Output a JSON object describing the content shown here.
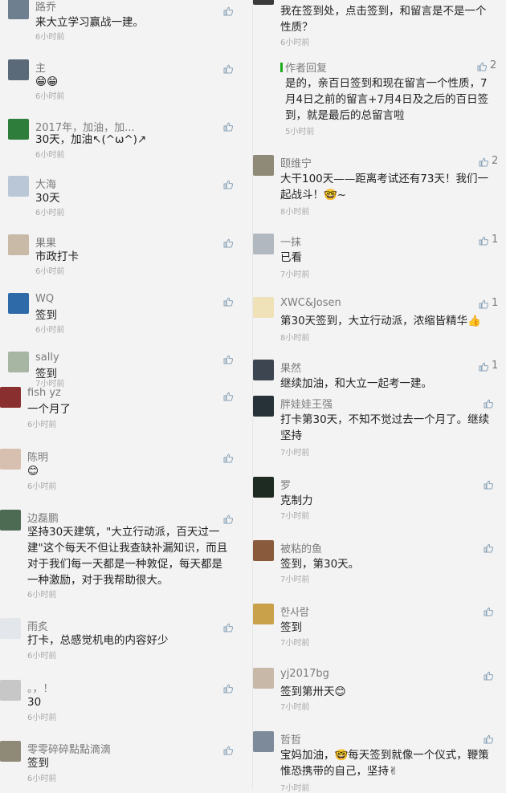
{
  "left": [
    {
      "name": "路乔",
      "text": "来大立学习赢战一建。",
      "time": "6小时前"
    },
    {
      "name": "主",
      "text": "😁😁",
      "time": "6小时前"
    },
    {
      "name": "2017年，加油，加...",
      "text": "30天，加油↖(^ω^)↗",
      "time": "6小时前"
    },
    {
      "name": "大海",
      "text": "30天",
      "time": "6小时前"
    },
    {
      "name": "果果",
      "text": "市政打卡",
      "time": "6小时前"
    },
    {
      "name": "WQ",
      "text": "签到",
      "time": "6小时前"
    },
    {
      "name": "sally",
      "text": "签到",
      "time": "7小时前"
    },
    {
      "name": "fish yz",
      "text": "一个月了",
      "time": "6小时前"
    },
    {
      "name": "陈明",
      "text": "😊",
      "time": "6小时前"
    },
    {
      "name": "边磊鹏",
      "text": "坚持30天建筑，\"大立行动派，百天过一建\"这个每天不但让我查缺补漏知识，而且对于我们每一天都是一种敦促，每天都是一种激励，对于我帮助很大。",
      "time": "6小时前"
    },
    {
      "name": "雨炙",
      "text": "打卡，总感觉机电的内容好少",
      "time": "6小时前"
    },
    {
      "name": "。，！",
      "text": "30",
      "time": "6小时前"
    },
    {
      "name": "零零碎碎點點滴滴",
      "text": "签到",
      "time": "6小时前"
    }
  ],
  "right": [
    {
      "text": "我在签到处，点击签到，和留言是不是一个性质？",
      "time": "6小时前"
    },
    {
      "reply_label": "作者回复",
      "text": "是的，亲百日签到和现在留言一个性质，7月4日之前的留言+7月4日及之后的百日签到，就是最后的总留言啦",
      "time": "5小时前",
      "likes": "2"
    },
    {
      "name": "颐维宁",
      "text": "大干100天——距离考试还有73天！我们一起战斗！🤓~",
      "time": "8小时前",
      "likes": "2"
    },
    {
      "name": "一抹",
      "text": "已看",
      "time": "7小时前",
      "likes": "1"
    },
    {
      "name": "XWC&Josen",
      "text": "第30天签到，大立行动派，浓缩皆精华👍",
      "time": "8小时前",
      "likes": "1"
    },
    {
      "name": "果然",
      "text": "继续加油，和大立一起考一建。",
      "time": "",
      "likes": "1"
    },
    {
      "name": "胖娃娃王强",
      "text": "打卡第30天，不知不觉过去一个月了。继续坚持",
      "time": "7小时前"
    },
    {
      "name": "罗",
      "text": "克制力",
      "time": "7小时前"
    },
    {
      "name": "被粘的鱼",
      "text": "签到，第30天。",
      "time": "7小时前"
    },
    {
      "name": "한사람",
      "text": "签到",
      "time": "7小时前"
    },
    {
      "name": "yj2017bg",
      "text": "签到第卅天😊",
      "time": "7小时前"
    },
    {
      "name": "哲哲",
      "text": "宝妈加油，🤓每天签到就像一个仪式，鞭策惟恐携带的自己，坚持✌",
      "time": "7小时前"
    }
  ],
  "colors": {
    "like_icon": "#8aa3b8",
    "reply_bar": "#1aad19",
    "name": "#7b7b7b",
    "time": "#a9a9a9"
  }
}
